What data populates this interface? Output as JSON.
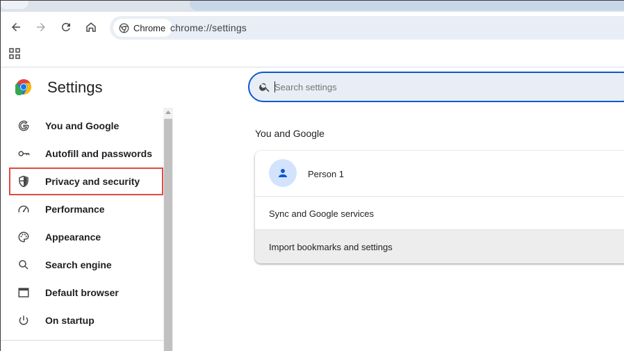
{
  "browser": {
    "omnibox": {
      "site_chip": "Chrome",
      "url": "chrome://settings"
    }
  },
  "settings": {
    "title": "Settings",
    "search_placeholder": "Search settings",
    "sidebar": {
      "items": [
        {
          "label": "You and Google",
          "icon": "google-g-icon"
        },
        {
          "label": "Autofill and passwords",
          "icon": "key-icon"
        },
        {
          "label": "Privacy and security",
          "icon": "shield-icon",
          "highlighted": true
        },
        {
          "label": "Performance",
          "icon": "speedometer-icon"
        },
        {
          "label": "Appearance",
          "icon": "palette-icon"
        },
        {
          "label": "Search engine",
          "icon": "search-icon"
        },
        {
          "label": "Default browser",
          "icon": "browser-window-icon"
        },
        {
          "label": "On startup",
          "icon": "power-icon"
        }
      ]
    },
    "main": {
      "section_title": "You and Google",
      "card": {
        "person_name": "Person 1",
        "rows": [
          "Sync and Google services",
          "Import bookmarks and settings"
        ]
      }
    }
  },
  "colors": {
    "accent": "#0b57d0",
    "highlight_border": "#e04a3f",
    "omnibox_bg": "#e9eef6"
  }
}
